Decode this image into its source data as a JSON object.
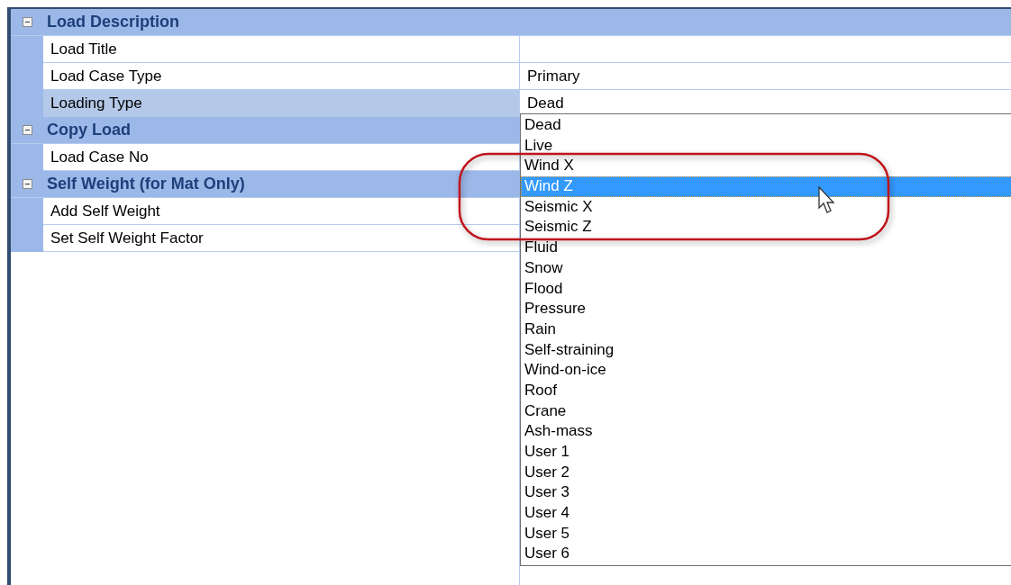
{
  "sections": [
    {
      "title": "Load Description",
      "expanded": true,
      "rows": [
        {
          "label": "Load Title",
          "selected": false
        },
        {
          "label": "Load Case Type",
          "value": "Primary",
          "selected": false
        },
        {
          "label": "Loading Type",
          "value": "Dead",
          "selected": true
        }
      ]
    },
    {
      "title": "Copy Load",
      "expanded": true,
      "rows": [
        {
          "label": "Load Case No",
          "selected": false
        }
      ]
    },
    {
      "title": "Self Weight (for Mat Only)",
      "expanded": true,
      "rows": [
        {
          "label": "Add Self Weight",
          "selected": false
        },
        {
          "label": "Set Self Weight Factor",
          "selected": false
        }
      ]
    }
  ],
  "dropdown": {
    "items": [
      {
        "label": "Dead",
        "selected": false
      },
      {
        "label": "Live",
        "selected": false
      },
      {
        "label": "Wind X",
        "selected": false
      },
      {
        "label": "Wind Z",
        "selected": true
      },
      {
        "label": "Seismic X",
        "selected": false
      },
      {
        "label": "Seismic Z",
        "selected": false
      },
      {
        "label": "Fluid",
        "selected": false
      },
      {
        "label": "Snow",
        "selected": false
      },
      {
        "label": "Flood",
        "selected": false
      },
      {
        "label": "Pressure",
        "selected": false
      },
      {
        "label": "Rain",
        "selected": false
      },
      {
        "label": "Self-straining",
        "selected": false
      },
      {
        "label": "Wind-on-ice",
        "selected": false
      },
      {
        "label": "Roof",
        "selected": false
      },
      {
        "label": "Crane",
        "selected": false
      },
      {
        "label": "Ash-mass",
        "selected": false
      },
      {
        "label": "User 1",
        "selected": false
      },
      {
        "label": "User 2",
        "selected": false
      },
      {
        "label": "User 3",
        "selected": false
      },
      {
        "label": "User 4",
        "selected": false
      },
      {
        "label": "User 5",
        "selected": false
      },
      {
        "label": "User 6",
        "selected": false
      }
    ]
  }
}
